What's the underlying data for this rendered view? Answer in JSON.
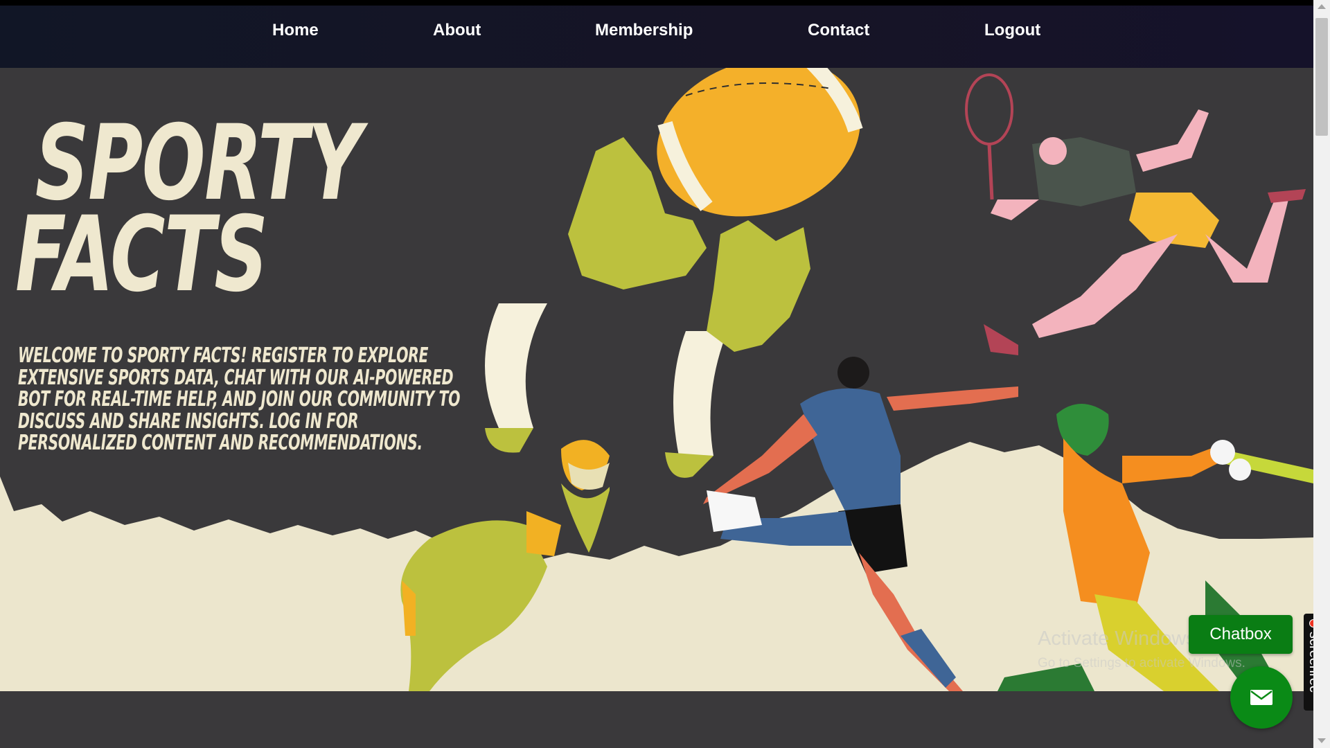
{
  "nav": {
    "items": [
      {
        "label": "Home"
      },
      {
        "label": "About"
      },
      {
        "label": "Membership"
      },
      {
        "label": "Contact"
      },
      {
        "label": "Logout"
      }
    ]
  },
  "hero": {
    "title_line1": "SPORTY",
    "title_line2": "FACTS",
    "welcome_text": "Welcome to Sporty Facts! Register to explore extensive sports data, chat with our AI-powered bot for real-time help, and join our community to discuss and share insights. Log in for personalized content and recommendations."
  },
  "illustrations": [
    "american-football-player",
    "tennis-player",
    "soccer-player",
    "cricket-batsman"
  ],
  "chat": {
    "button_label": "Chatbox",
    "fab_icon": "mail-icon"
  },
  "os_overlay": {
    "watermark_title": "Activate Windows",
    "watermark_sub": "Go to Settings to activate Windows.",
    "screenrec_label": "screenrec"
  },
  "colors": {
    "navbar": "#131526",
    "hero_bg": "#3a393b",
    "cream": "#efe8cf",
    "chat_green": "#0a7d14"
  }
}
